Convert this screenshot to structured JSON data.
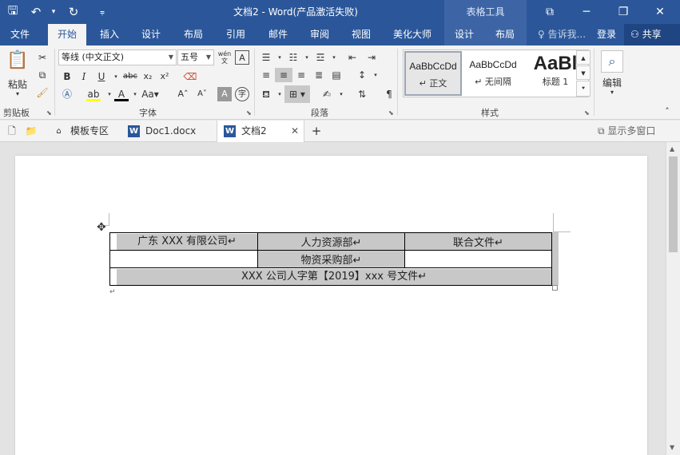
{
  "titlebar": {
    "title": "文档2 - Word(产品激活失败)",
    "context_tools": "表格工具"
  },
  "tabs": [
    "文件",
    "开始",
    "插入",
    "设计",
    "布局",
    "引用",
    "邮件",
    "审阅",
    "视图",
    "美化大师",
    "设计",
    "布局"
  ],
  "tell_me": "告诉我...",
  "login": "登录",
  "share": "共享",
  "ribbon": {
    "clipboard": {
      "paste": "粘贴",
      "label": "剪贴板"
    },
    "font": {
      "name": "等线 (中文正文)",
      "size": "五号",
      "label": "字体"
    },
    "paragraph": {
      "label": "段落"
    },
    "styles": {
      "label": "样式",
      "items": [
        {
          "sample": "AaBbCcDd",
          "name": "↵ 正文"
        },
        {
          "sample": "AaBbCcDd",
          "name": "↵ 无间隔"
        },
        {
          "sample": "AaBl",
          "name": "标题 1"
        }
      ]
    },
    "editing": {
      "label": "编辑"
    }
  },
  "doctabs": {
    "items": [
      "模板专区",
      "Doc1.docx",
      "文档2"
    ],
    "multi_window": "显示多窗口"
  },
  "table": {
    "r1c1": "广东 XXX 有限公司↵",
    "r1c2": "人力资源部↵",
    "r1c3": "联合文件↵",
    "r2c2": "物资采购部↵",
    "r3": "XXX 公司人字第【2019】xxx 号文件↵"
  }
}
